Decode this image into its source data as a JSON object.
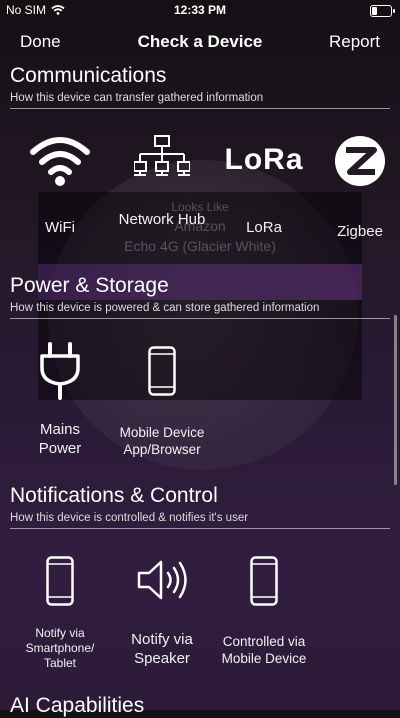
{
  "status": {
    "carrier": "No SIM",
    "time": "12:33 PM",
    "wifi_icon": "wifi-icon",
    "battery_level": 0.3
  },
  "nav": {
    "done_label": "Done",
    "title": "Check a Device",
    "report_label": "Report"
  },
  "overlay": {
    "line1": "Looks Like",
    "line2": "Amazon",
    "line3": "Echo 4G (Glacier White)"
  },
  "sections": {
    "communications": {
      "title": "Communications",
      "subtitle": "How this device can transfer gathered information",
      "items": [
        {
          "label": "WiFi",
          "icon": "wifi-icon"
        },
        {
          "label": "Network Hub",
          "icon": "network-hub-icon"
        },
        {
          "label": "LoRa",
          "icon": "lora-icon",
          "logo_text": "LoRa"
        },
        {
          "label": "Zigbee",
          "icon": "zigbee-icon"
        }
      ]
    },
    "power": {
      "title": "Power & Storage",
      "subtitle": "How this device is powered & can store gathered information",
      "items": [
        {
          "label": "Mains Power",
          "icon": "plug-icon"
        },
        {
          "label": "Mobile Device App/Browser",
          "icon": "phone-icon"
        }
      ]
    },
    "notifications": {
      "title": "Notifications & Control",
      "subtitle": "How this device is controlled & notifies it's user",
      "items": [
        {
          "label": "Notify via Smartphone/ Tablet",
          "icon": "phone-icon"
        },
        {
          "label": "Notify via Speaker",
          "icon": "speaker-icon"
        },
        {
          "label": "Controlled via Mobile Device",
          "icon": "phone-icon"
        }
      ]
    },
    "ai": {
      "title": "AI Capabilities"
    }
  }
}
